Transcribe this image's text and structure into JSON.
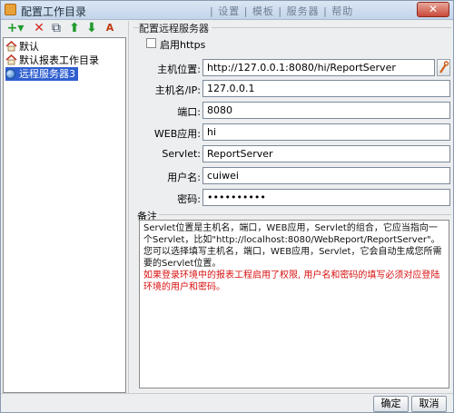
{
  "window": {
    "title": "配置工作目录",
    "background_text": "| 设置 | 模板 | 服务器 | 帮助"
  },
  "toolbar": {
    "add_label": "+▾",
    "delete_label": "✕",
    "copy_label": "⧉",
    "up_label": "⬆",
    "down_label": "⬇",
    "sort_label": "A"
  },
  "tree": {
    "items": [
      {
        "label": "默认",
        "icon": "house-icon"
      },
      {
        "label": "默认报表工作目录",
        "icon": "house-icon"
      },
      {
        "label": "远程服务器3",
        "icon": "globe-icon",
        "selected": true
      }
    ]
  },
  "form": {
    "group_title": "配置远程服务器",
    "https_label": "启用https",
    "https_checked": false,
    "fields": {
      "host": {
        "label": "主机位置:",
        "value": "http://127.0.0.1:8080/hi/ReportServer"
      },
      "hostname": {
        "label": "主机名/IP:",
        "value": "127.0.0.1"
      },
      "port": {
        "label": "端口:",
        "value": "8080"
      },
      "webapp": {
        "label": "WEB应用:",
        "value": "hi"
      },
      "servlet": {
        "label": "Servlet:",
        "value": "ReportServer"
      },
      "username": {
        "label": "用户名:",
        "value": "cuiwei"
      },
      "password": {
        "label": "密码:",
        "value": "••••••••••"
      }
    },
    "memo_title": "备注",
    "memo_black": "Servlet位置是主机名，端口，WEB应用，Servlet的组合，它应当指向一个Servlet，比如\"http://localhost:8080/WebReport/ReportServer\"。您可以选择填写主机名，端口，WEB应用，Servlet，它会自动生成您所需要的Servlet位置。",
    "memo_red": "如果登录环境中的报表工程启用了权限, 用户名和密码的填写必须对应登陆环境的用户和密码。"
  },
  "buttons": {
    "ok": "确定",
    "cancel": "取消"
  },
  "colors": {
    "selection": "#2f5fd0",
    "warning_text": "#d81010",
    "add_green": "#1f9a2a",
    "delete_red": "#d22a1e"
  }
}
